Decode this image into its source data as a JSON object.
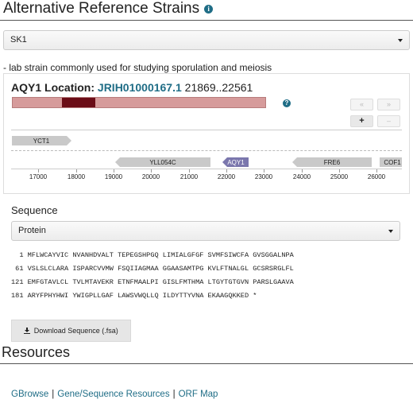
{
  "header": {
    "title": "Alternative Reference Strains",
    "info_icon": "i"
  },
  "strain_select": {
    "value": "SK1"
  },
  "strain_description": "- lab strain commonly used for studying sporulation and meiosis",
  "location": {
    "gene": "AQY1 Location:",
    "contig": "JRIH01000167.1",
    "range": "21869..22561",
    "help_icon": "?"
  },
  "track_nav": {
    "prev_label": "«",
    "next_label": "»",
    "zoom_in_label": "+",
    "zoom_out_label": "–"
  },
  "features": [
    {
      "label": "YCT1",
      "direction": "right"
    },
    {
      "label": "YLL054C",
      "direction": "left"
    },
    {
      "label": "AQY1",
      "direction": "left",
      "highlight": true
    },
    {
      "label": "FRE6",
      "direction": "left"
    },
    {
      "label": "COF1",
      "direction": "right"
    }
  ],
  "axis_ticks": [
    "17000",
    "18000",
    "19000",
    "20000",
    "21000",
    "22000",
    "23000",
    "24000",
    "25000",
    "26000"
  ],
  "sequence": {
    "label": "Sequence",
    "type": "Protein",
    "lines": [
      "  1 MFLWCAYVIC NVANHDVALT TEPEGSHPGQ LIMIALGFGF SVMFSIWCFA GVSGGALNPA",
      " 61 VSLSLCLARA ISPARCVVMW FSQIIAGMAA GGAASAMTPG KVLFTNALGL GCSRSRGLFL",
      "121 EMFGTAVLCL TVLMTAVEKR ETNFMAALPI GISLFMTHMA LTGYTGTGVN PARSLGAAVA",
      "181 ARYFPHYHWI YWIGPLLGAF LAWSVWQLLQ ILDYTTYVNA EKAAGQKKED *"
    ],
    "download_label": "Download Sequence (.fsa)",
    "download_icon": "download-icon"
  },
  "resources": {
    "title": "Resources",
    "links": [
      "GBrowse",
      "Gene/Sequence Resources",
      "ORF Map"
    ],
    "separator": "|"
  },
  "colors": {
    "link": "#1f6d86",
    "gene_bar": "#d69b9b",
    "gene_mark": "#6b0d17",
    "feature_highlight": "#7b77ad"
  }
}
